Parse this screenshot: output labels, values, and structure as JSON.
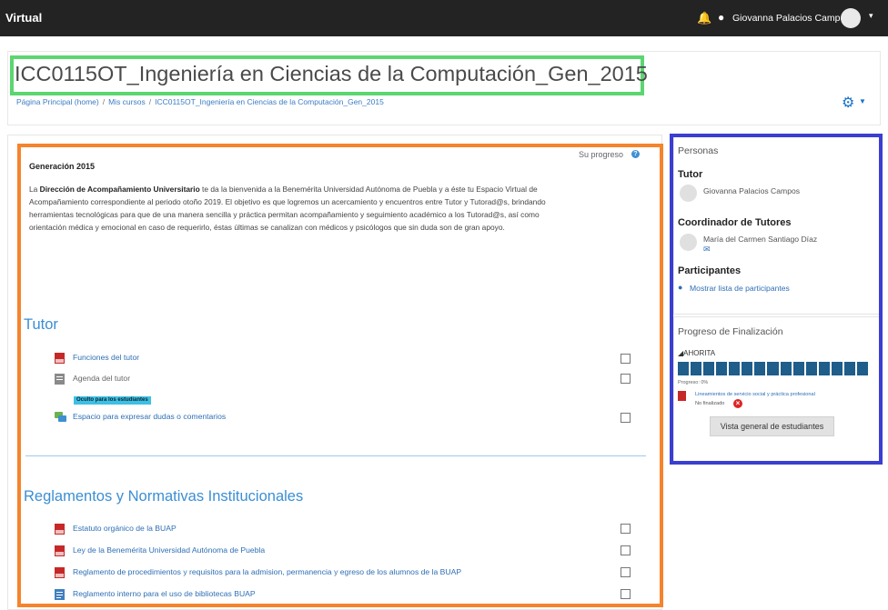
{
  "topbar": {
    "brand": "Virtual",
    "user_name": "Giovanna Palacios Campos"
  },
  "header": {
    "course_title": "ICC0115OT_Ingeniería en Ciencias de la Computación_Gen_2015",
    "breadcrumb": [
      "Página Principal (home)",
      "Mis cursos",
      "ICC0115OT_Ingeniería en Ciencias de la Computación_Gen_2015"
    ]
  },
  "main": {
    "progress_label": "Su progreso",
    "generation_heading": "Generación 2015",
    "intro_pre": "La ",
    "intro_bold": "Dirección de Acompañamiento Universitario",
    "intro_rest": " te da la bienvenida a la Benemérita Universidad Autónoma de Puebla y a éste tu Espacio Virtual de Acompañamiento correspondiente al periodo otoño 2019. El objetivo es que logremos un acercamiento y encuentros entre Tutor y Tutorad@s, brindando herramientas tecnológicas para que de una manera sencilla y práctica permitan acompañamiento y seguimiento académico a los Tutorad@s, así como orientación médica y emocional en caso de requerirlo, éstas últimas se canalizan con médicos y psicólogos que sin duda son de gran apoyo.",
    "sections": [
      {
        "title": "Tutor",
        "activities": [
          {
            "label": "Funciones del tutor",
            "icon": "pdf-icon"
          },
          {
            "label": "Agenda del tutor",
            "icon": "file-icon"
          },
          {
            "label": "Espacio para expresar dudas o comentarios",
            "icon": "forum-icon"
          }
        ],
        "badge": "Oculto para los estudiantes"
      },
      {
        "title": "Reglamentos y Normativas Institucionales",
        "activities": [
          {
            "label": "Estatuto orgánico de la BUAP",
            "icon": "pdf-icon"
          },
          {
            "label": "Ley de la Benemérita Universidad Autónoma de Puebla",
            "icon": "pdf-icon"
          },
          {
            "label": "Reglamento de procedimientos y requisitos para la admision, permanencia y egreso de los alumnos de la BUAP",
            "icon": "pdf-icon"
          },
          {
            "label": "Reglamento interno para el uso de bibliotecas BUAP",
            "icon": "doc-icon"
          }
        ]
      }
    ]
  },
  "sidebar": {
    "personas": {
      "title": "Personas",
      "tutor_heading": "Tutor",
      "tutor_name": "Giovanna Palacios Campos",
      "coord_heading": "Coordinador de Tutores",
      "coord_name": "María del Carmen Santiago Díaz",
      "participants_heading": "Participantes",
      "participants_link": "Mostrar lista de participantes"
    },
    "completion": {
      "title": "Progreso de Finalización",
      "group": "AHORITA",
      "segments": 15,
      "progress_text": "Progreso: 0%",
      "progress_value": 0,
      "item": "Lineamientos de servicio social y práctica profesional",
      "item_status": "No finalizado",
      "overview_button": "Vista general de estudiantes"
    }
  },
  "colors": {
    "topbar": "#232323",
    "link": "#2e6fb5",
    "section_title": "#3b8ed4",
    "highlight_green": "#5bd670",
    "highlight_orange": "#f5842d",
    "highlight_blue": "#3a3ed1",
    "progress_bar": "#1f5d8a",
    "badge": "#3dc0e3"
  }
}
